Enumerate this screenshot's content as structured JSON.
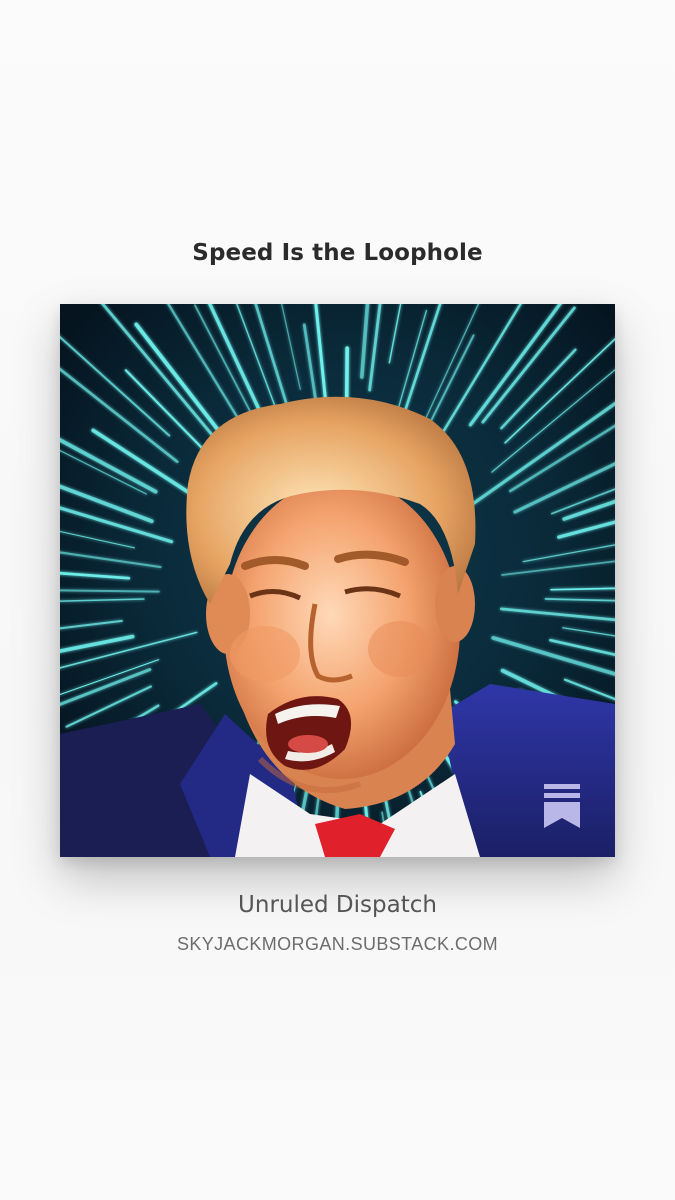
{
  "post": {
    "title": "Speed Is the Loophole"
  },
  "cover_image": {
    "description_icon": "speed-lines-portrait-image",
    "background_color": "#071c2a",
    "ray_color": "#6ff2ee",
    "suit_color": "#2a2f8f",
    "tie_color": "#e0202a",
    "badge_icon": "substack-bookmark-icon",
    "badge_color": "#b9b6e8"
  },
  "publication": {
    "name": "Unruled Dispatch",
    "url": "SKYJACKMORGAN.SUBSTACK.COM"
  }
}
